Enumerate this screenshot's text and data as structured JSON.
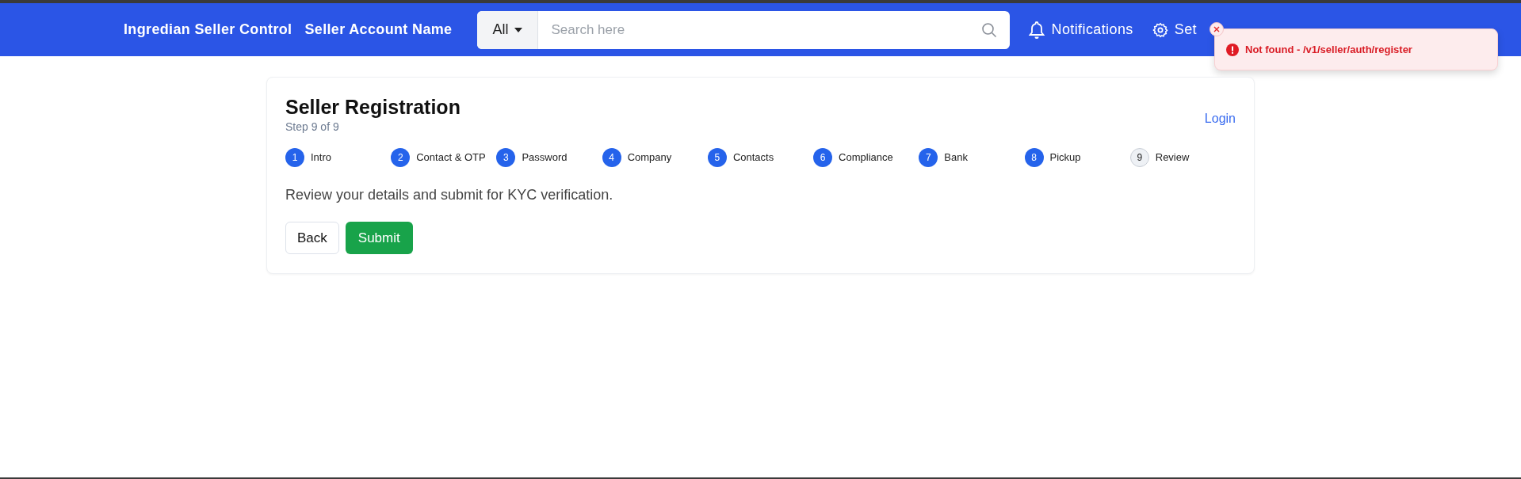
{
  "navbar": {
    "brand": "Ingredian Seller Control",
    "account": "Seller Account Name",
    "search": {
      "scope": "All",
      "placeholder": "Search here"
    },
    "items": [
      {
        "kind": "bell",
        "label": "Notifications"
      },
      {
        "kind": "gear",
        "label": "Set"
      }
    ]
  },
  "toast": {
    "message": "Not found - /v1/seller/auth/register"
  },
  "card": {
    "title": "Seller Registration",
    "subtitle": "Step 9 of 9",
    "login": "Login",
    "steps": [
      {
        "number": "1",
        "label": "Intro",
        "completed": true
      },
      {
        "number": "2",
        "label": "Contact & OTP",
        "completed": true
      },
      {
        "number": "3",
        "label": "Password",
        "completed": true
      },
      {
        "number": "4",
        "label": "Company",
        "completed": true
      },
      {
        "number": "5",
        "label": "Contacts",
        "completed": true
      },
      {
        "number": "6",
        "label": "Compliance",
        "completed": true
      },
      {
        "number": "7",
        "label": "Bank",
        "completed": true
      },
      {
        "number": "8",
        "label": "Pickup",
        "completed": true
      },
      {
        "number": "9",
        "label": "Review",
        "completed": false
      }
    ],
    "description": "Review your details and submit for KYC verification.",
    "buttons": [
      {
        "kind": "outline",
        "label": "Back"
      },
      {
        "kind": "primary",
        "label": "Submit"
      }
    ]
  }
}
